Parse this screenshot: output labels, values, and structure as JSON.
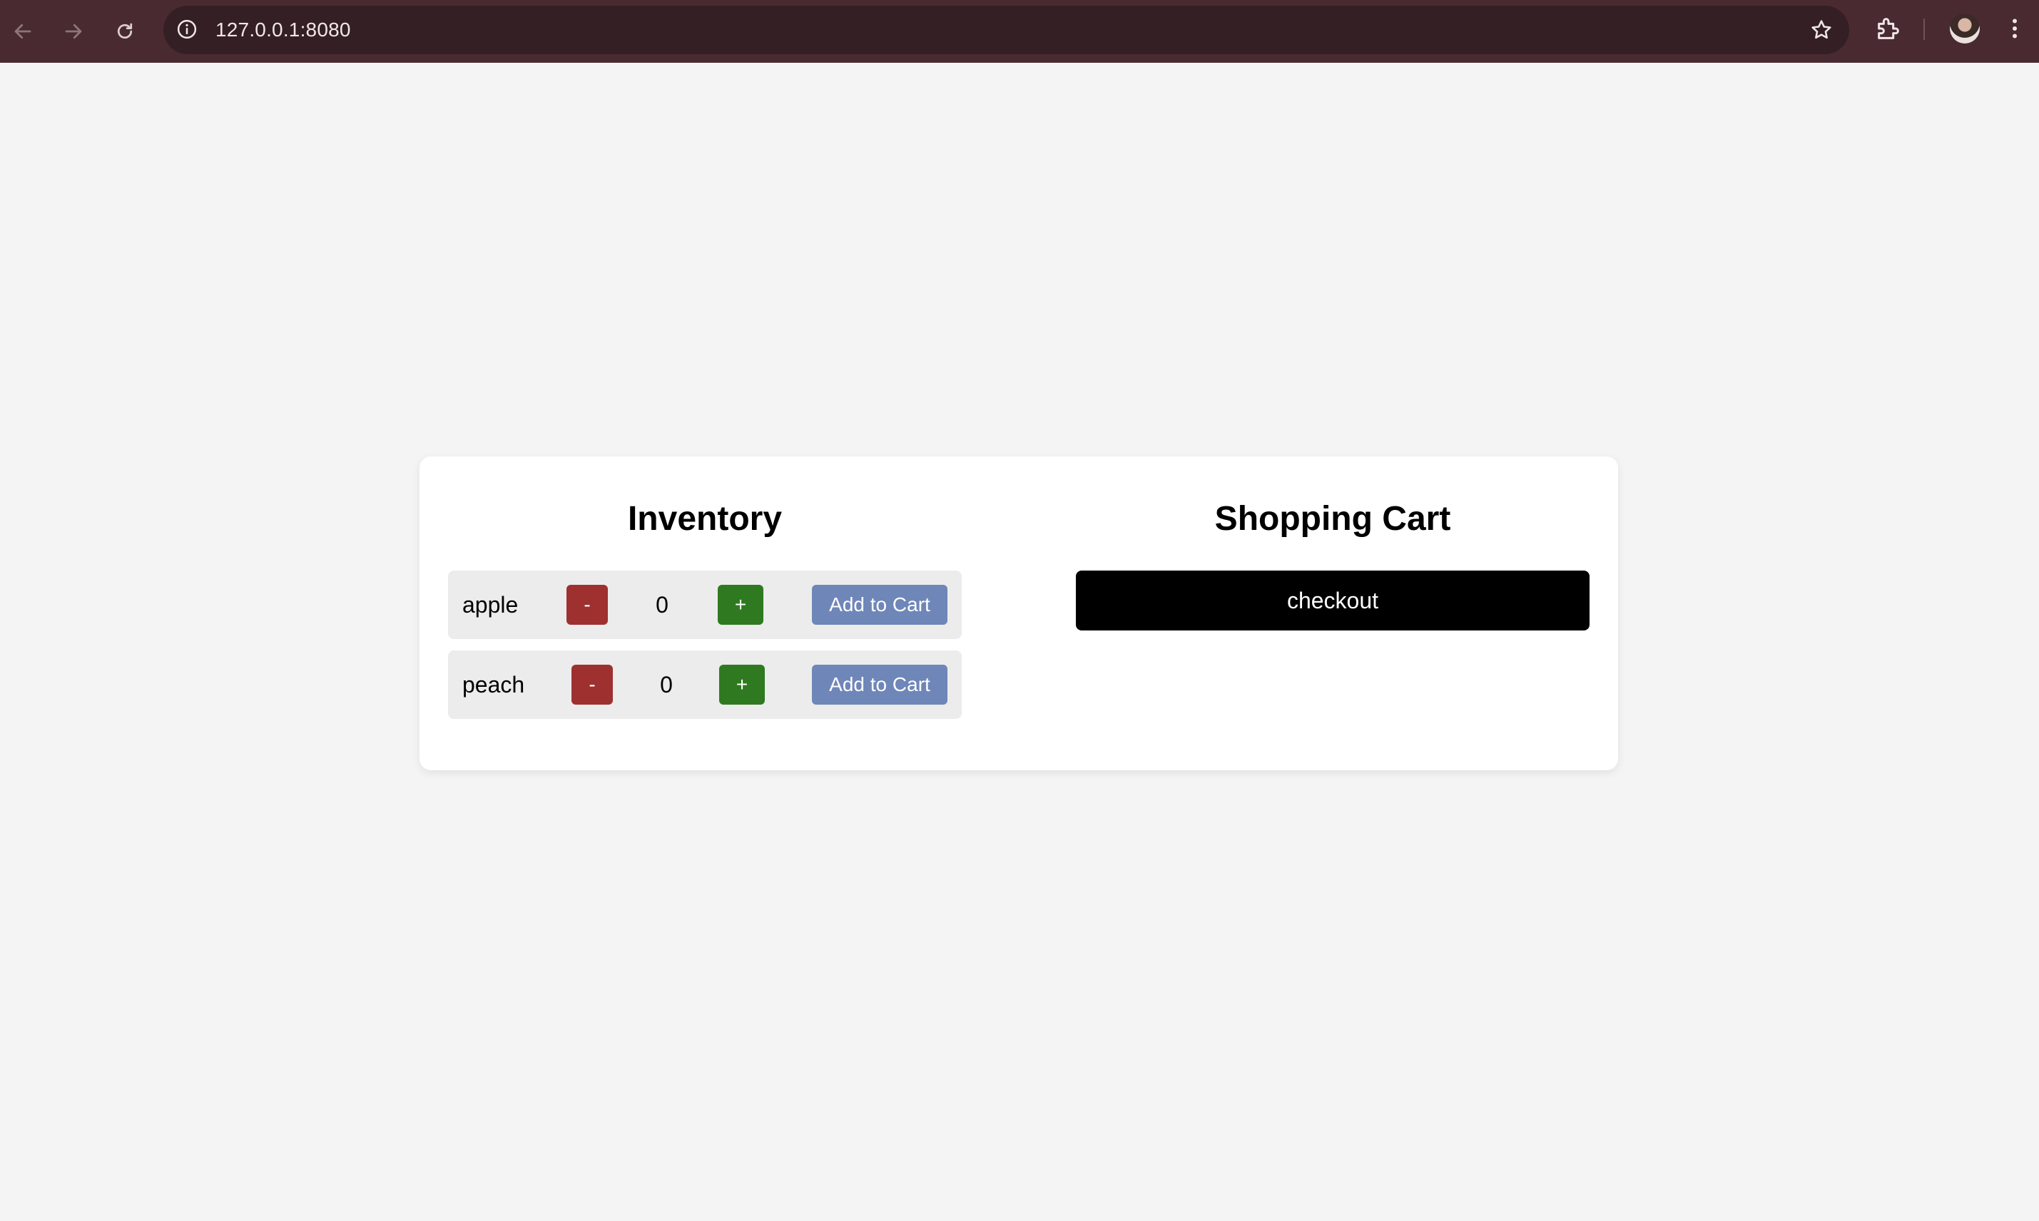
{
  "browser": {
    "url": "127.0.0.1:8080",
    "icons": [
      "back-arrow-icon",
      "forward-arrow-icon",
      "reload-icon",
      "info-icon",
      "star-icon",
      "extensions-icon",
      "avatar",
      "kebab-menu-icon"
    ],
    "colors": {
      "frame": "#4a2a31",
      "omnibox": "#341f24"
    }
  },
  "inventory": {
    "title": "Inventory",
    "items": [
      {
        "name": "apple",
        "minus_label": "-",
        "quantity": "0",
        "plus_label": "+",
        "add_label": "Add to Cart"
      },
      {
        "name": "peach",
        "minus_label": "-",
        "quantity": "0",
        "plus_label": "+",
        "add_label": "Add to Cart"
      }
    ]
  },
  "cart": {
    "title": "Shopping Cart",
    "checkout_label": "checkout"
  },
  "colors": {
    "background": "#f4f4f4",
    "card": "#ffffff",
    "row": "#ececec",
    "minus": "#9e3030",
    "plus": "#2f7a20",
    "add_to_cart": "#6f86b8",
    "checkout": "#000000"
  }
}
